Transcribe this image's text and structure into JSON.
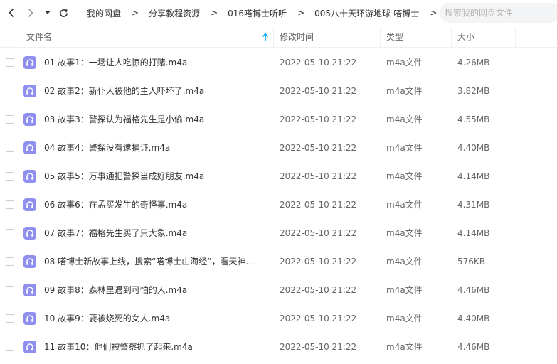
{
  "toolbar": {
    "breadcrumbs": [
      "我的网盘",
      "分享教程资源",
      "016嗒博士听听",
      "005八十天环游地球-嗒博士"
    ],
    "crumb_arrow": ">",
    "search_placeholder": "搜索我的网盘文件"
  },
  "header": {
    "name": "文件名",
    "modified": "修改时间",
    "type": "类型",
    "size": "大小"
  },
  "colors": {
    "audio_icon": "#8f8ff0",
    "accent": "#06a7ff"
  },
  "rows": [
    {
      "name": "01 故事1：一场让人吃惊的打赌.m4a",
      "modified": "2022-05-10 21:22",
      "type": "m4a文件",
      "size": "4.26MB"
    },
    {
      "name": "02 故事2：新仆人被他的主人吓坏了.m4a",
      "modified": "2022-05-10 21:22",
      "type": "m4a文件",
      "size": "3.82MB"
    },
    {
      "name": "03 故事3：警探认为福格先生是小偷.m4a",
      "modified": "2022-05-10 21:22",
      "type": "m4a文件",
      "size": "4.55MB"
    },
    {
      "name": "04 故事4：警探没有逮捕证.m4a",
      "modified": "2022-05-10 21:22",
      "type": "m4a文件",
      "size": "4.40MB"
    },
    {
      "name": "05 故事5：万事通把警探当成好朋友.m4a",
      "modified": "2022-05-10 21:22",
      "type": "m4a文件",
      "size": "4.14MB"
    },
    {
      "name": "06 故事6：在孟买发生的奇怪事.m4a",
      "modified": "2022-05-10 21:22",
      "type": "m4a文件",
      "size": "4.31MB"
    },
    {
      "name": "07 故事7：福格先生买了只大象.m4a",
      "modified": "2022-05-10 21:22",
      "type": "m4a文件",
      "size": "4.14MB"
    },
    {
      "name": "08 嗒博士新故事上线，搜索“嗒博士山海经”，看天神…",
      "modified": "2022-05-10 21:22",
      "type": "m4a文件",
      "size": "576KB"
    },
    {
      "name": "09 故事8：森林里遇到可怕的人.m4a",
      "modified": "2022-05-10 21:22",
      "type": "m4a文件",
      "size": "4.46MB"
    },
    {
      "name": "10 故事9：要被烧死的女人.m4a",
      "modified": "2022-05-10 21:22",
      "type": "m4a文件",
      "size": "4.40MB"
    },
    {
      "name": "11 故事10：他们被警察抓了起来.m4a",
      "modified": "2022-05-10 21:22",
      "type": "m4a文件",
      "size": "4.46MB"
    }
  ]
}
